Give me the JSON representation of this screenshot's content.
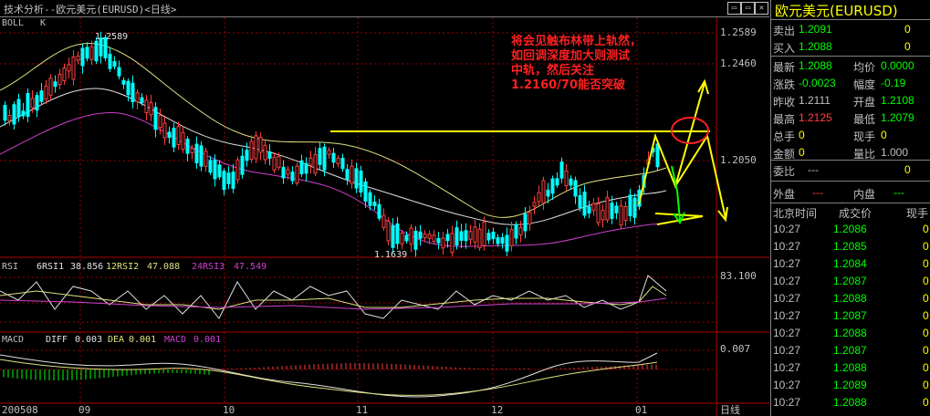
{
  "window": {
    "title": "技术分析--欧元美元(EURUSD)<日线>",
    "buttons": [
      "▭",
      "▭",
      "✕"
    ]
  },
  "chart": {
    "main_label": "BOLL",
    "main_sub": "K",
    "price_ticks": [
      "1.2589",
      "1.2460",
      "1.2050"
    ],
    "high_marker": "1.2589",
    "low_marker": "1.1639",
    "annotation": [
      "将会见触布林带上轨然，",
      "如回调深度加大则测试",
      "中轨，然后关注",
      "1.2160/70能否突破"
    ],
    "rsi": {
      "name": "RSI",
      "p1": "6RSI1",
      "v1": "38.856",
      "p2": "12RSI2",
      "v2": "47.088",
      "p3": "24RSI3",
      "v3": "47.549",
      "tick": "83.100"
    },
    "macd": {
      "name": "MACD",
      "p1": "DIFF",
      "v1": "0.003",
      "p2": "DEA",
      "v2": "0.001",
      "p3": "MACD",
      "v3": "0.001",
      "tick": "0.007"
    },
    "x_labels": [
      "200508",
      "09",
      "10",
      "11",
      "12",
      "01"
    ],
    "period": "日线",
    "colors": {
      "up": "#ff4040",
      "down": "#00ffff",
      "boll_upper": "#e0e080",
      "boll_mid": "#e0e0e0",
      "boll_lower": "#d040d0",
      "annot": "#ff2020",
      "arrow": "#ffff00",
      "green": "#00ff00"
    }
  },
  "quote": {
    "title": "欧元美元(EURUSD)",
    "sell": {
      "label": "卖出",
      "price": "1.2091",
      "vol": "0"
    },
    "buy": {
      "label": "买入",
      "price": "1.2088",
      "vol": "0"
    },
    "rows": [
      {
        "l1": "最新",
        "v1": "1.2088",
        "c1": "#00ff00",
        "l2": "均价",
        "v2": "0.0000",
        "c2": "#00ff00"
      },
      {
        "l1": "涨跌",
        "v1": "-0.0023",
        "c1": "#00ff00",
        "l2": "幅度",
        "v2": "-0.19",
        "c2": "#00ff00"
      },
      {
        "l1": "昨收",
        "v1": "1.2111",
        "c1": "#c0c0c0",
        "l2": "开盘",
        "v2": "1.2108",
        "c2": "#00ff00"
      },
      {
        "l1": "最高",
        "v1": "1.2125",
        "c1": "#ff4040",
        "l2": "最低",
        "v2": "1.2079",
        "c2": "#00ff00"
      },
      {
        "l1": "总手",
        "v1": "0",
        "c1": "#ffff00",
        "l2": "现手",
        "v2": "0",
        "c2": "#ffff00"
      },
      {
        "l1": "金额",
        "v1": "0",
        "c1": "#ffff00",
        "l2": "量比",
        "v2": "1.000",
        "c2": "#c0c0c0"
      }
    ],
    "weibi": {
      "label": "委比",
      "val": "---",
      "num": "0"
    },
    "waipan": {
      "label": "外盘",
      "val": "---"
    },
    "neipan": {
      "label": "内盘",
      "val": "---"
    },
    "ticks_header": [
      "北京时间",
      "成交价",
      "现手"
    ],
    "ticks": [
      {
        "t": "10:27",
        "p": "1.2086",
        "v": "0"
      },
      {
        "t": "10:27",
        "p": "1.2085",
        "v": "0"
      },
      {
        "t": "10:27",
        "p": "1.2084",
        "v": "0"
      },
      {
        "t": "10:27",
        "p": "1.2087",
        "v": "0"
      },
      {
        "t": "10:27",
        "p": "1.2088",
        "v": "0"
      },
      {
        "t": "10:27",
        "p": "1.2087",
        "v": "0"
      },
      {
        "t": "10:27",
        "p": "1.2088",
        "v": "0"
      },
      {
        "t": "10:27",
        "p": "1.2087",
        "v": "0"
      },
      {
        "t": "10:27",
        "p": "1.2088",
        "v": "0"
      },
      {
        "t": "10:27",
        "p": "1.2089",
        "v": "0"
      },
      {
        "t": "10:27",
        "p": "1.2088",
        "v": "0"
      }
    ]
  }
}
